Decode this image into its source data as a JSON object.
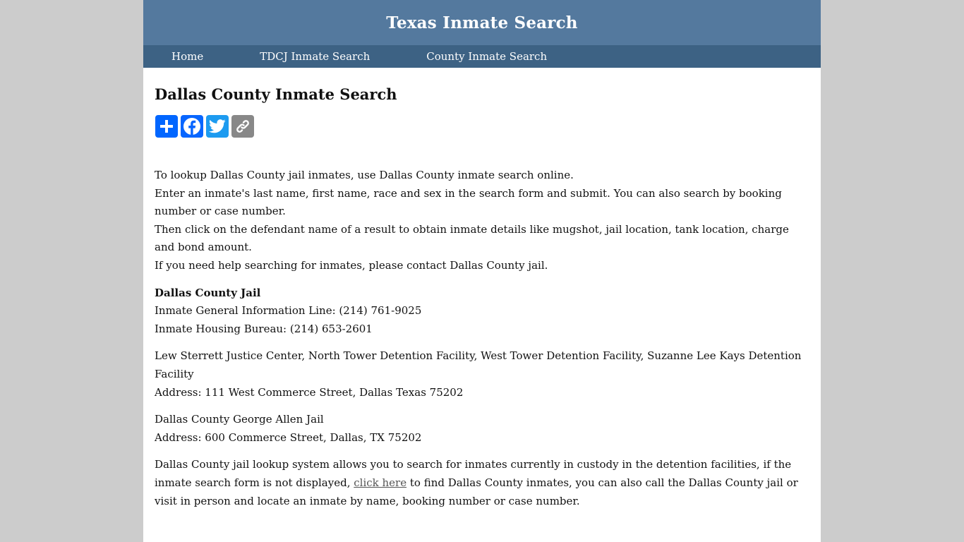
{
  "header": {
    "title": "Texas Inmate Search"
  },
  "nav": {
    "items": [
      {
        "label": "Home"
      },
      {
        "label": "TDCJ Inmate Search"
      },
      {
        "label": "County Inmate Search"
      }
    ]
  },
  "main": {
    "title": "Dallas County Inmate Search",
    "share_icons": [
      "add-share-icon",
      "facebook-icon",
      "twitter-icon",
      "copy-link-icon"
    ],
    "intro": [
      "To lookup Dallas County jail inmates, use Dallas County inmate search online.",
      "Enter an inmate's last name, first name, race and sex in the search form and submit. You can also search by booking number or case number.",
      "Then click on the defendant name of a result to obtain inmate details like mugshot, jail location, tank location, charge and bond amount.",
      "If you need help searching for inmates, please contact Dallas County jail."
    ],
    "jail": {
      "name": "Dallas County Jail",
      "lines": [
        "Inmate General Information Line: (214) 761-9025",
        "Inmate Housing Bureau: (214) 653-2601"
      ]
    },
    "facility1": {
      "name": "Lew Sterrett Justice Center, North Tower Detention Facility, West Tower Detention Facility, Suzanne Lee Kays Detention Facility",
      "address": "Address: 111 West Commerce Street, Dallas Texas 75202"
    },
    "facility2": {
      "name": "Dallas County George Allen Jail",
      "address": "Address: 600 Commerce Street, Dallas, TX 75202"
    },
    "closing": {
      "before": "Dallas County jail lookup system allows you to search for inmates currently in custody in the detention facilities, if the inmate search form is not displayed, ",
      "link": "click here",
      "after": " to find Dallas County inmates, you can also call the Dallas County jail or visit in person and locate an inmate by name, booking number or case number."
    }
  },
  "colors": {
    "header_bg": "#54799e",
    "nav_bg": "#3d6284",
    "page_bg": "#cccccc"
  }
}
